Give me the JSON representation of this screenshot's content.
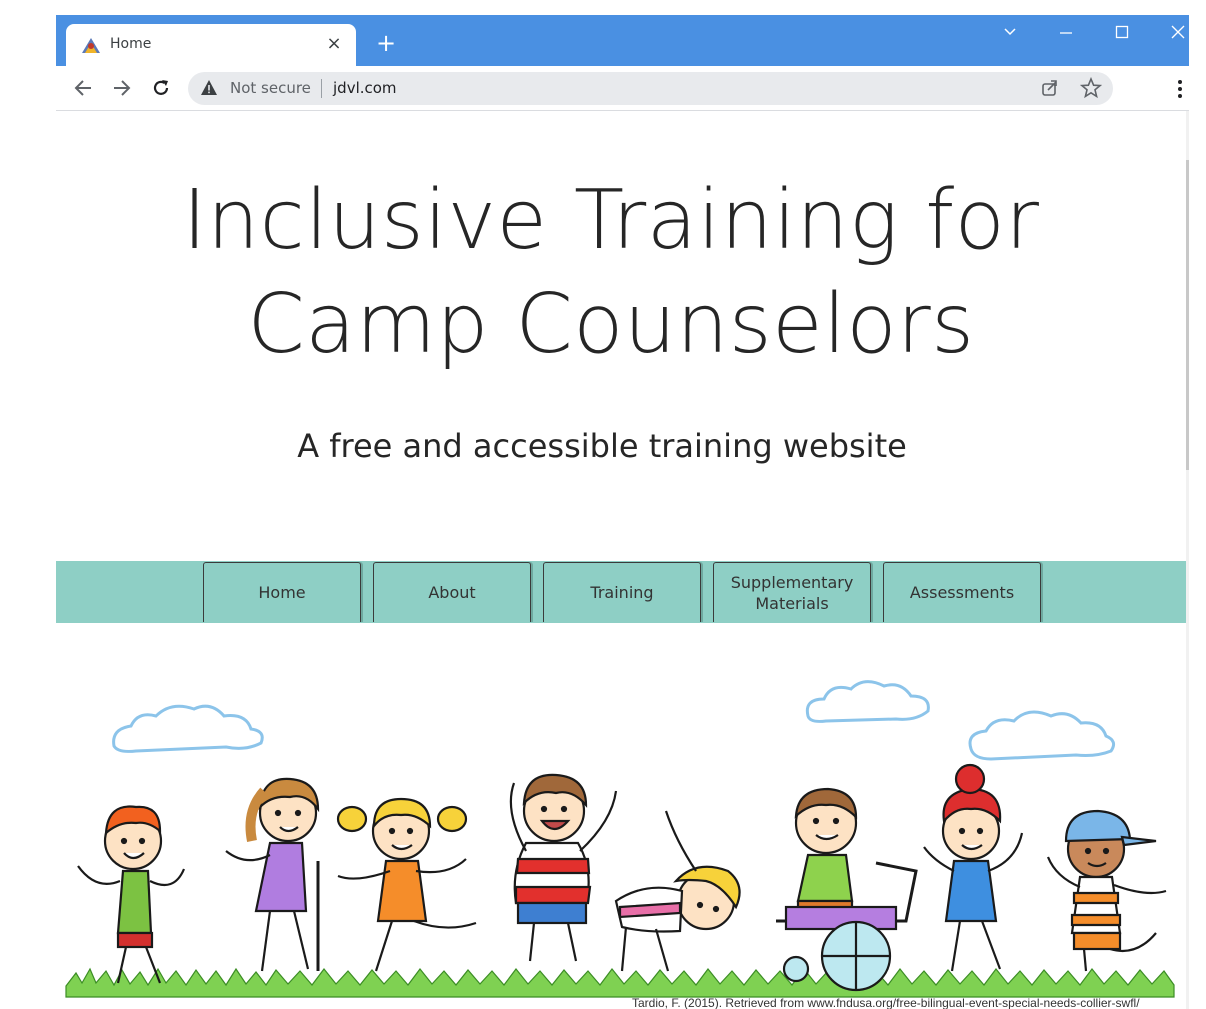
{
  "browser": {
    "tab_title": "Home",
    "tab_close": "×",
    "new_tab": "+",
    "security_label": "Not secure",
    "url": "jdvl.com",
    "icons": [
      "favicon-icon",
      "back-icon",
      "forward-icon",
      "reload-icon",
      "warning-icon",
      "share-icon",
      "star-icon",
      "menu-icon",
      "tab-search-icon",
      "minimize-icon",
      "maximize-icon",
      "close-icon"
    ],
    "colors": {
      "tabstrip": "#4a90e2",
      "omnibox": "#e8eaed"
    }
  },
  "site": {
    "title_line1": "Inclusive Training for",
    "title_line2": "Camp Counselors",
    "subtitle": "A free and accessible training website",
    "nav": [
      {
        "label": "Home"
      },
      {
        "label": "About"
      },
      {
        "label": "Training"
      },
      {
        "label": "Supplementary Materials"
      },
      {
        "label": "Assessments"
      }
    ],
    "hero_credit": "Tardio, F. (2015). Retrieved from www.fndusa.org/free-bilingual-event-special-needs-collier-swfl/",
    "colors": {
      "nav_bg": "#8ecfc5",
      "text": "#262626"
    }
  }
}
